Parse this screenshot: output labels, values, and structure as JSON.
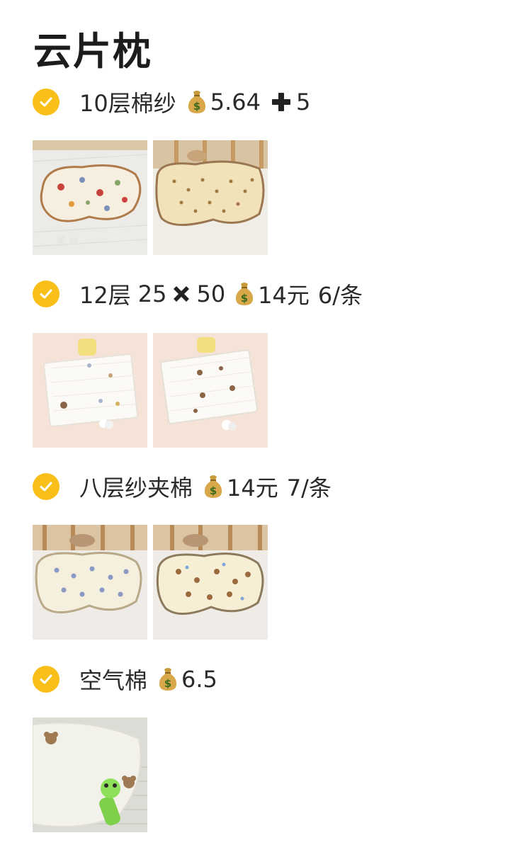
{
  "page": {
    "title": "云片枕"
  },
  "items": [
    {
      "name": "10层棉纱",
      "price": "5.64",
      "extra_icon": "heavy-plus-icon",
      "extra": "5",
      "images": [
        "floral-pillow-photo",
        "beige-floral-pillow-photo"
      ]
    },
    {
      "name": "12层",
      "dim_a": "25",
      "extra_icon": "heavy-multiplication-icon",
      "dim_b": "50",
      "price": "14元",
      "note": "6/条",
      "images": [
        "white-rect-pillow-photo",
        "white-bear-pillow-photo"
      ]
    },
    {
      "name": "八层纱夹棉",
      "price": "14元",
      "note": "7/条",
      "images": [
        "blue-floral-cloud-pillow-photo",
        "bear-cloud-pillow-photo"
      ]
    },
    {
      "name": "空气棉",
      "price": "6.5",
      "images": [
        "air-cotton-pillow-photo"
      ]
    }
  ],
  "icons": {
    "check": "check-circle-icon",
    "money": "money-bag-icon"
  },
  "colors": {
    "check_bg": "#f7bf17",
    "text": "#2a2a2a"
  }
}
